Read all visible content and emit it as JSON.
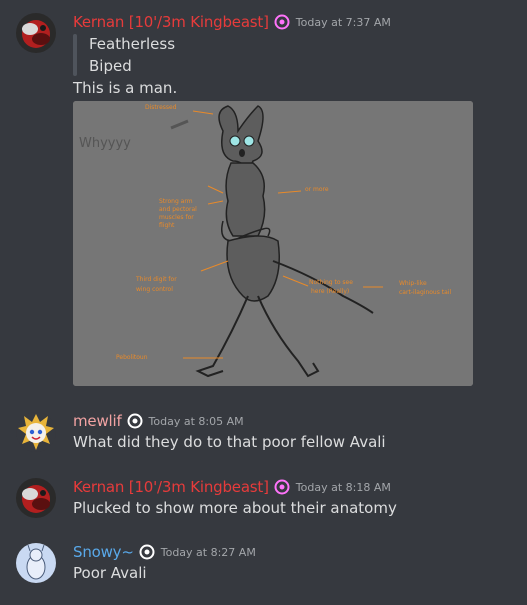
{
  "messages": [
    {
      "username": "Kernan [10'/3m Kingbeast]",
      "username_color": "#e73b3b",
      "timestamp": "Today at 7:37 AM",
      "quote": [
        "Featherless",
        "Biped"
      ],
      "text": "This is a man."
    },
    {
      "username": "mewlif",
      "username_color": "#f2a3a3",
      "timestamp": "Today at 8:05 AM",
      "text": "What did they do to that poor fellow Avali"
    },
    {
      "username": "Kernan [10'/3m Kingbeast]",
      "username_color": "#e73b3b",
      "timestamp": "Today at 8:18 AM",
      "text": "Plucked to show more about their anatomy"
    },
    {
      "username": "Snowy~",
      "username_color": "#59a9ea",
      "timestamp": "Today at 8:27 AM",
      "text": "Poor Avali"
    }
  ],
  "attachment": {
    "scribble": "Whyyyy",
    "notes": [
      "Distressed",
      "Strong arm",
      "and pectoral",
      "muscles for",
      "flight",
      "or more",
      "Third digit for",
      "wing control",
      "Nothing to see",
      "here (Really)",
      "Whip-like",
      "cart-ilaginous tail",
      "Pebolitoun"
    ]
  },
  "colors": {
    "background": "#36393f",
    "annotation": "#e88a2a",
    "timestamp": "#a3a6aa"
  }
}
